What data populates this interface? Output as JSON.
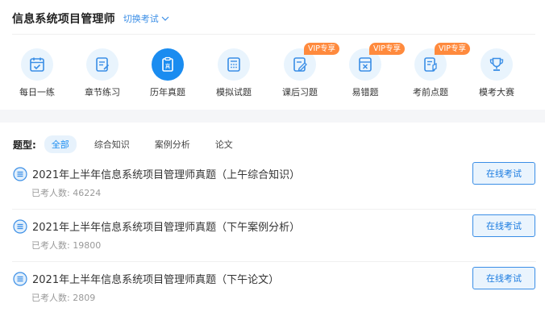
{
  "header": {
    "exam_title": "信息系统项目管理师",
    "switch_label": "切换考试"
  },
  "nav": [
    {
      "label": "每日一练",
      "icon": "calendar-check-icon",
      "vip": ""
    },
    {
      "label": "章节练习",
      "icon": "notebook-pen-icon",
      "vip": ""
    },
    {
      "label": "历年真题",
      "icon": "clipboard-exam-icon",
      "vip": "",
      "active": true
    },
    {
      "label": "模拟试题",
      "icon": "calculator-grid-icon",
      "vip": ""
    },
    {
      "label": "课后习题",
      "icon": "pencil-doc-icon",
      "vip": "VIP专享"
    },
    {
      "label": "易错题",
      "icon": "error-x-card-icon",
      "vip": "VIP专享"
    },
    {
      "label": "考前点题",
      "icon": "exam-pen-icon",
      "vip": "VIP专享"
    },
    {
      "label": "模考大赛",
      "icon": "trophy-icon",
      "vip": ""
    }
  ],
  "filter": {
    "label": "题型:",
    "options": [
      "全部",
      "综合知识",
      "案例分析",
      "论文"
    ],
    "selected": "全部"
  },
  "papers": [
    {
      "title": "2021年上半年信息系统项目管理师真题（上午综合知识）",
      "meta_label": "已考人数:",
      "count": "46224",
      "button": "在线考试"
    },
    {
      "title": "2021年上半年信息系统项目管理师真题（下午案例分析）",
      "meta_label": "已考人数:",
      "count": "19800",
      "button": "在线考试"
    },
    {
      "title": "2021年上半年信息系统项目管理师真题（下午论文）",
      "meta_label": "已考人数:",
      "count": "2809",
      "button": "在线考试"
    }
  ],
  "colors": {
    "accent": "#1a8cf0",
    "vip": "#ff8a3d",
    "icon_bg": "#e9f4fd"
  }
}
